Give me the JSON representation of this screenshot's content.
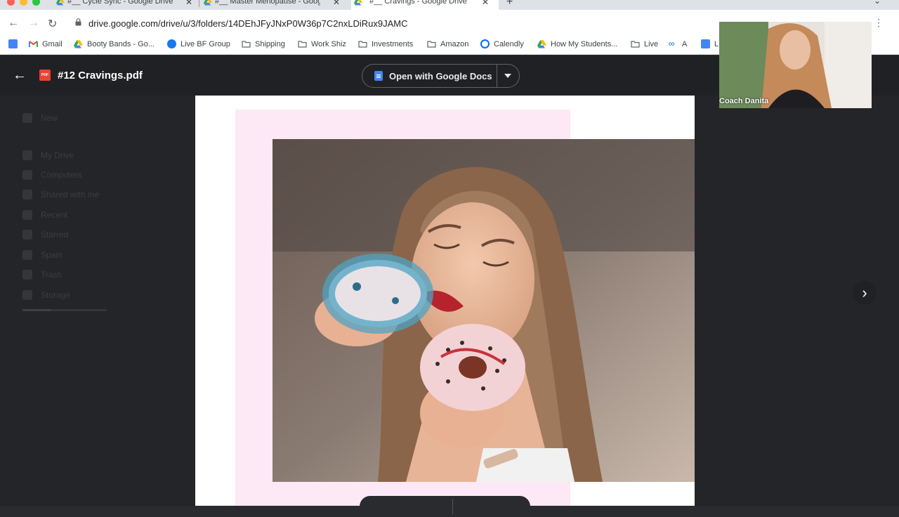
{
  "browser": {
    "tabs": [
      {
        "title": "#__ Cycle Sync - Google Drive",
        "active": false
      },
      {
        "title": "#__ Master Menopause - Goog",
        "active": false
      },
      {
        "title": "#__ Cravings - Google Drive",
        "active": true
      }
    ],
    "new_tab_label": "+",
    "tab_close_label": "✕",
    "url": "drive.google.com/drive/u/3/folders/14DEhJFyJNxP0W36p7C2nxLDiRux9JAMC"
  },
  "bookmarks": [
    {
      "label": "",
      "icon": "google-docs-icon"
    },
    {
      "label": "Gmail",
      "icon": "gmail-icon"
    },
    {
      "label": "Booty Bands - Go...",
      "icon": "google-drive-icon"
    },
    {
      "label": "Live BF Group",
      "icon": "facebook-icon"
    },
    {
      "label": "Shipping",
      "icon": "folder-icon"
    },
    {
      "label": "Work Shiz",
      "icon": "folder-icon"
    },
    {
      "label": "Investments",
      "icon": "folder-icon"
    },
    {
      "label": "Amazon",
      "icon": "folder-icon"
    },
    {
      "label": "Calendly",
      "icon": "calendly-icon"
    },
    {
      "label": "How My Students...",
      "icon": "google-drive-icon"
    },
    {
      "label": "Live",
      "icon": "folder-icon"
    },
    {
      "label": "A",
      "icon": "meta-icon"
    },
    {
      "label": "L",
      "icon": "google-docs-icon"
    }
  ],
  "viewer": {
    "file_name": "#12 Cravings.pdf",
    "file_type_badge": "PDF",
    "open_with_label": "Open with Google Docs"
  },
  "drive_sidebar": [
    {
      "label": "New"
    },
    {
      "label": "My Drive"
    },
    {
      "label": "Computers"
    },
    {
      "label": "Shared with me"
    },
    {
      "label": "Recent"
    },
    {
      "label": "Starred"
    },
    {
      "label": "Spam"
    },
    {
      "label": "Trash"
    },
    {
      "label": "Storage"
    }
  ],
  "webcam": {
    "participant_name": "Coach Danita"
  },
  "colors": {
    "viewer_bg": "#202124",
    "page_pink": "#fde8f6",
    "accent_blue": "#4285f4",
    "pdf_red": "#ea4335"
  }
}
